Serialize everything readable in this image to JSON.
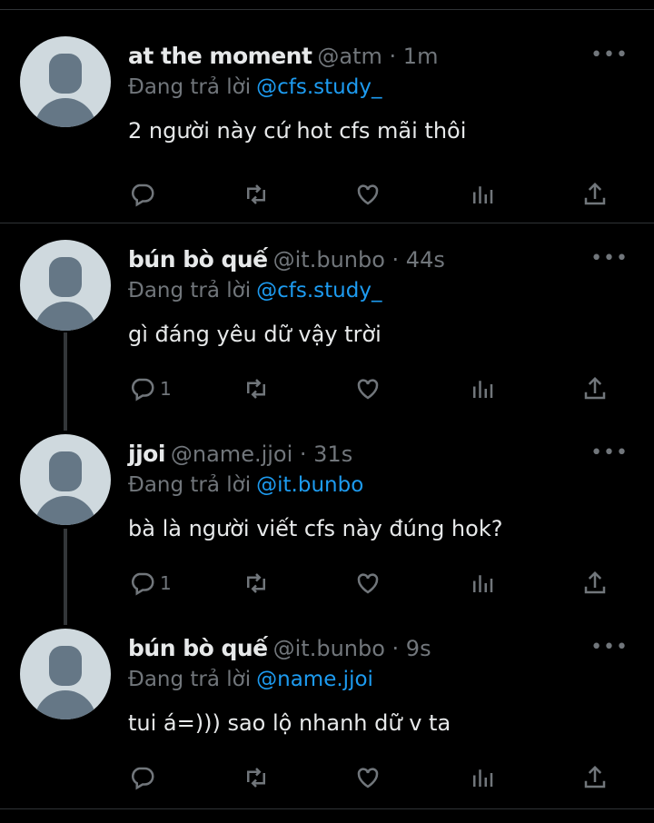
{
  "more_label": "•••",
  "reply_prefix": "Đang trả lời",
  "tweets": [
    {
      "name": "at the moment",
      "meta": "@atm · 1m",
      "reply_to": "@cfs.study_",
      "text": "2 người này cứ hot cfs mãi thôi",
      "reply_count": ""
    },
    {
      "name": "bún bò quế",
      "meta": "@it.bunbo · 44s",
      "reply_to": "@cfs.study_",
      "text": "gì đáng yêu dữ vậy trời",
      "reply_count": "1"
    },
    {
      "name": "jjoi",
      "meta": "@name.jjoi · 31s",
      "reply_to": "@it.bunbo",
      "text": "bà là người viết cfs này đúng hok?",
      "reply_count": "1"
    },
    {
      "name": "bún bò quế",
      "meta": "@it.bunbo · 9s",
      "reply_to": "@name.jjoi",
      "text": "tui á=))) sao lộ nhanh dữ v ta",
      "reply_count": ""
    }
  ],
  "icons": {
    "reply": "reply-icon",
    "retweet": "retweet-icon",
    "like": "heart-icon",
    "views": "views-icon",
    "share": "share-icon",
    "more": "more-icon"
  },
  "colors": {
    "background": "#000000",
    "text": "#e7e9ea",
    "muted": "#71767b",
    "link": "#1d9bf0",
    "divider": "#2f3336",
    "avatar_bg": "#cfd9de",
    "avatar_fg": "#657786"
  }
}
